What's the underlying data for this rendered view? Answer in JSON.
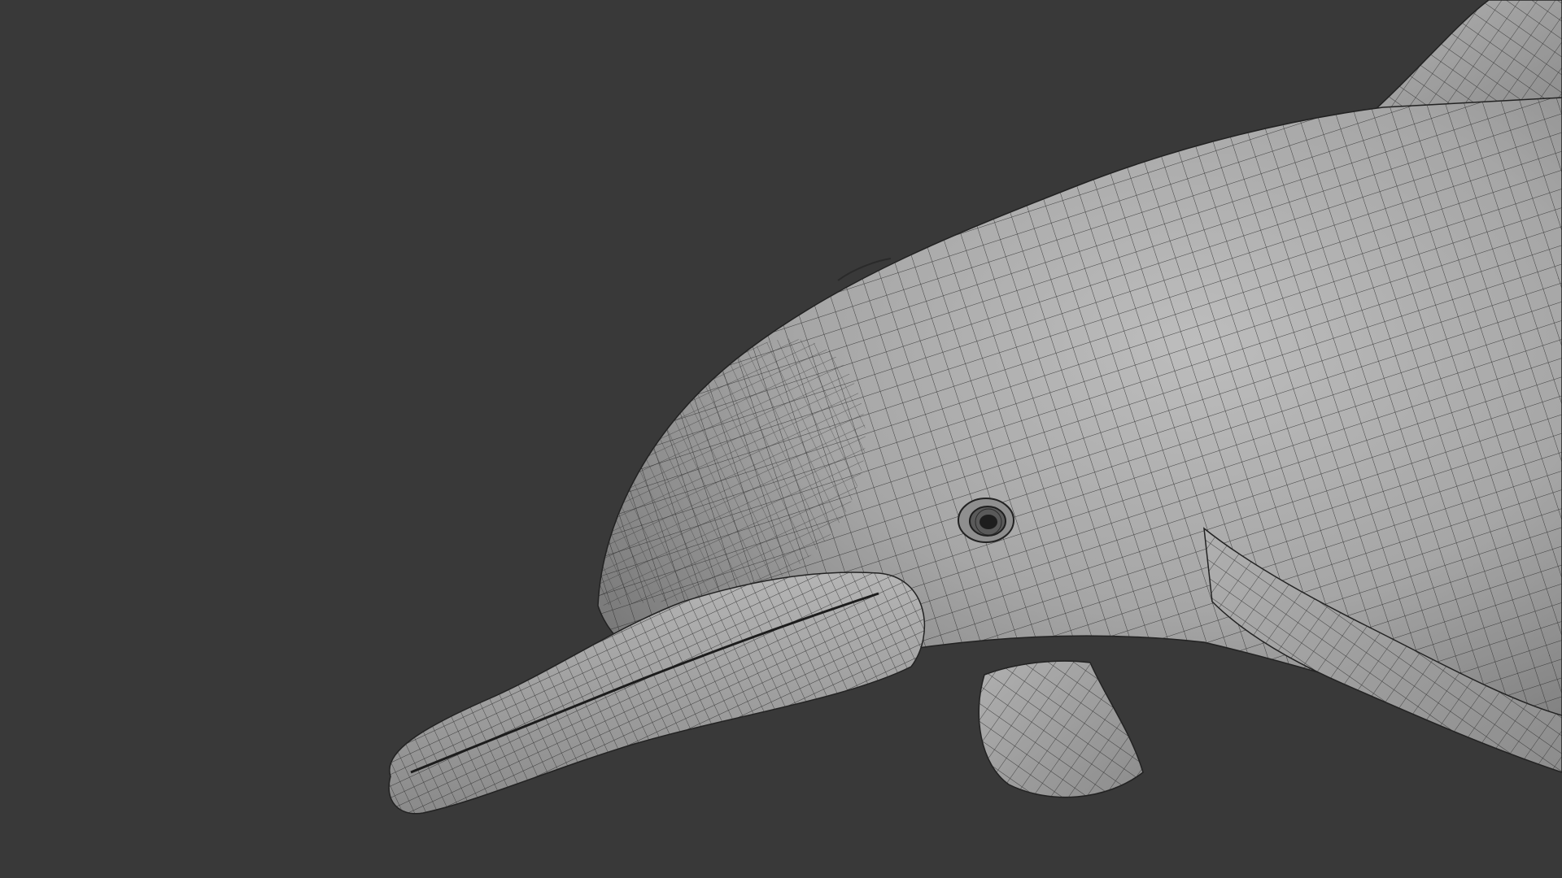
{
  "viewport": {
    "background_color": "#393939",
    "subject": "dolphin-wireframe-mesh",
    "mesh_fill_color": "#a9a9a9",
    "wire_color": "#2a2a2a",
    "eye_color": "#1e1e1e"
  }
}
